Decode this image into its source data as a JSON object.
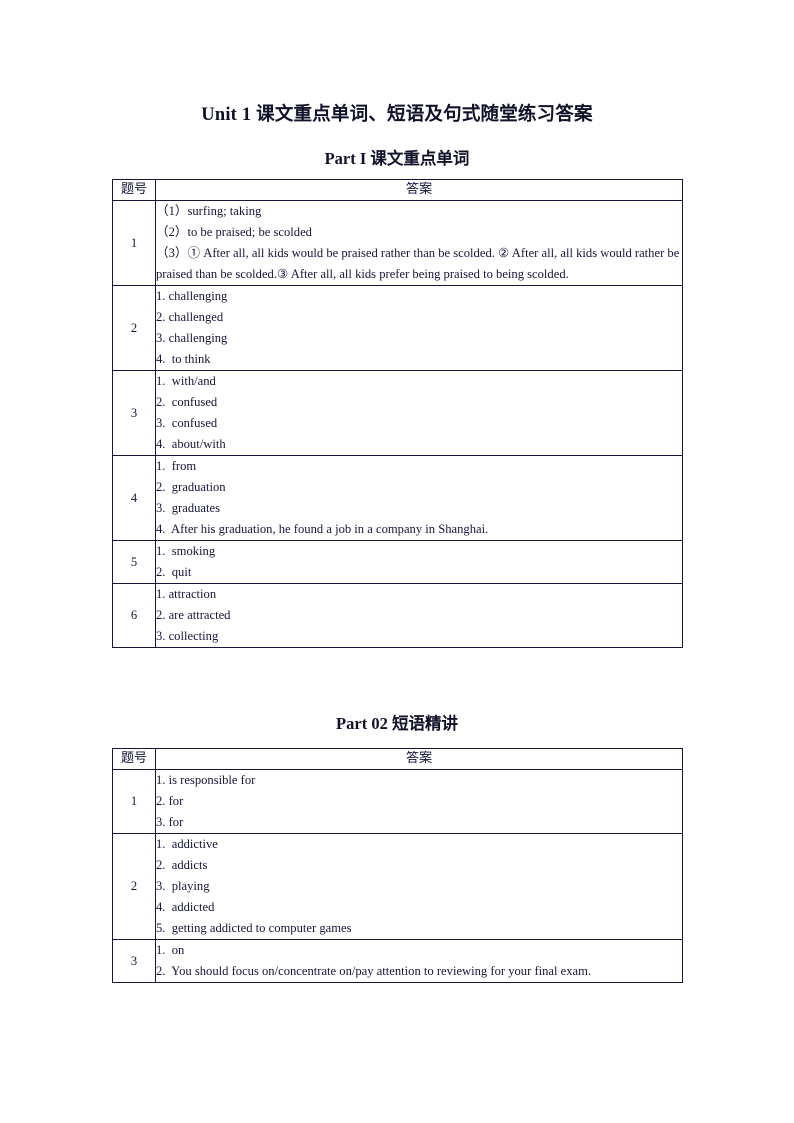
{
  "document": {
    "title": "Unit 1 课文重点单词、短语及句式随堂练习答案"
  },
  "sections": [
    {
      "heading": "Part I  课文重点单词",
      "table": {
        "columns": [
          "题号",
          "答案"
        ],
        "rows": [
          {
            "num": "1",
            "lines": [
              "（1）surfing; taking",
              "（2）to be praised; be scolded",
              "（3）① After all, all kids would be praised rather than be scolded. ② After all, all kids would rather be praised than be scolded.③ After all, all kids prefer being praised to being scolded."
            ]
          },
          {
            "num": "2",
            "lines": [
              "1. challenging",
              "2. challenged",
              "3. challenging",
              "4.  to think"
            ]
          },
          {
            "num": "3",
            "lines": [
              "1.  with/and",
              "2.  confused",
              "3.  confused",
              "4.  about/with"
            ]
          },
          {
            "num": "4",
            "lines": [
              "1.  from",
              "2.  graduation",
              "3.  graduates",
              "4.  After his graduation, he found a job in a company in Shanghai."
            ]
          },
          {
            "num": "5",
            "lines": [
              "1.  smoking",
              "2.  quit"
            ]
          },
          {
            "num": "6",
            "lines": [
              "1. attraction",
              "2. are attracted",
              "3. collecting"
            ]
          }
        ]
      }
    },
    {
      "heading": "Part 02 短语精讲",
      "table": {
        "columns": [
          "题号",
          "答案"
        ],
        "rows": [
          {
            "num": "1",
            "lines": [
              "1. is responsible for",
              "2. for",
              "3. for"
            ]
          },
          {
            "num": "2",
            "lines": [
              "1.  addictive",
              "2.  addicts",
              "3.  playing",
              "4.  addicted",
              "5.  getting addicted to computer games"
            ]
          },
          {
            "num": "3",
            "lines": [
              "1.  on",
              "2.  You should focus on/concentrate on/pay attention to reviewing for your final exam."
            ]
          }
        ]
      }
    }
  ],
  "colors": {
    "text": "#16163a",
    "border": "#16163a",
    "background": "#ffffff"
  }
}
